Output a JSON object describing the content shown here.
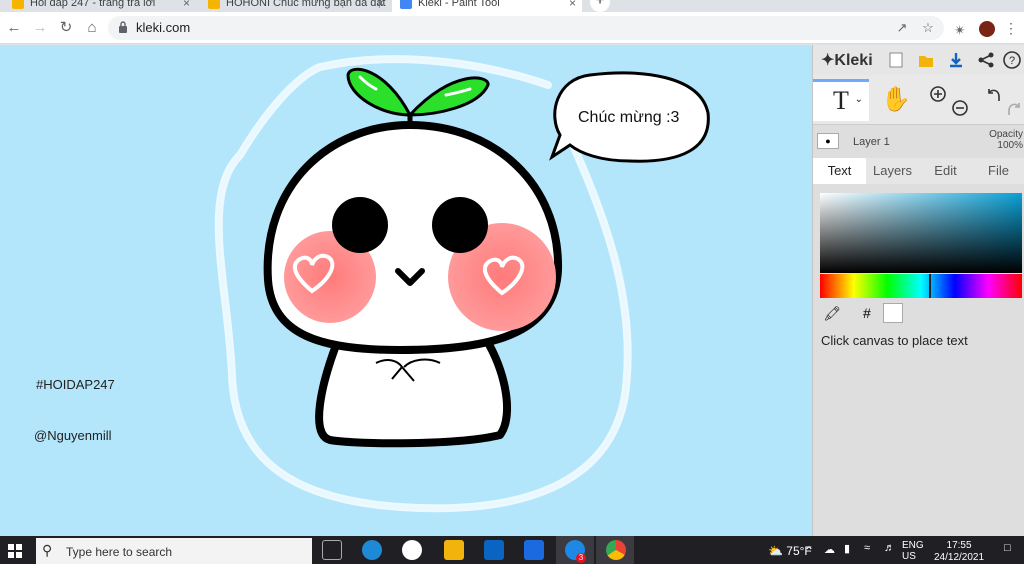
{
  "browser": {
    "tabs": [
      {
        "title": "Hỏi đáp 247 - trang trả lời",
        "active": false
      },
      {
        "title": "HOHONI Chúc mừng bạn đã đạt",
        "active": false
      },
      {
        "title": "Kleki - Paint Tool",
        "active": true
      }
    ],
    "new_tab_label": "+",
    "url": "kleki.com",
    "close_glyph": "×"
  },
  "canvas": {
    "speech_bubble_text": "Chúc mừng :3",
    "tag_text": "#HOIDAP247",
    "author_text": "@Nguyenmill",
    "background_color": "#b3e5fb"
  },
  "kleki": {
    "logo_text": "Kleki",
    "tool_label": "T",
    "tool_caret": "⌄",
    "layer_name": "Layer 1",
    "opacity_label": "Opacity",
    "opacity_value": "100%",
    "tabs": [
      "Text",
      "Layers",
      "Edit",
      "File"
    ],
    "active_tab": "Text",
    "hash_label": "#",
    "hint": "Click canvas to place text",
    "accent_color": "#6fa8ff"
  },
  "taskbar": {
    "search_placeholder": "Type here to search",
    "weather": "75°F",
    "lang_top": "ENG",
    "lang_bottom": "US",
    "time": "17:55",
    "date": "24/12/2021",
    "badge_count": "3"
  }
}
